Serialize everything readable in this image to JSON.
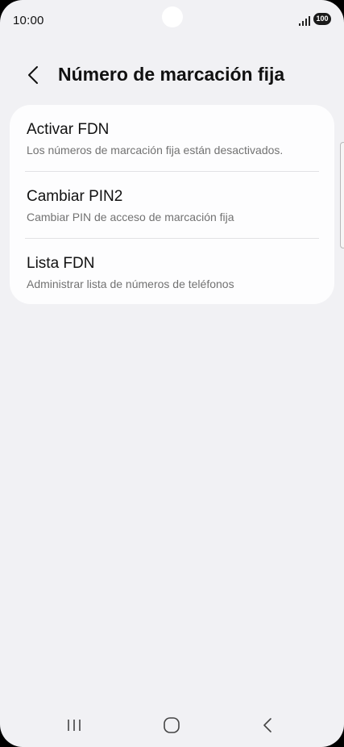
{
  "status_bar": {
    "time": "10:00",
    "battery": "100",
    "icons": [
      "signal-icon",
      "battery-icon"
    ]
  },
  "header": {
    "back_icon": "chevron-left-icon",
    "title": "Número de marcación fija"
  },
  "settings": {
    "items": [
      {
        "title": "Activar FDN",
        "subtitle": "Los números de marcación fija están desactivados."
      },
      {
        "title": "Cambiar PIN2",
        "subtitle": "Cambiar PIN de acceso de marcación fija"
      },
      {
        "title": "Lista FDN",
        "subtitle": "Administrar lista de números de teléfonos"
      }
    ]
  },
  "nav_bar": {
    "icons": [
      "recent-apps-icon",
      "home-icon",
      "back-icon"
    ]
  },
  "colors": {
    "background": "#f1f1f4",
    "card": "#fdfdfe",
    "title_text": "#111111",
    "subtitle_text": "#727272"
  }
}
